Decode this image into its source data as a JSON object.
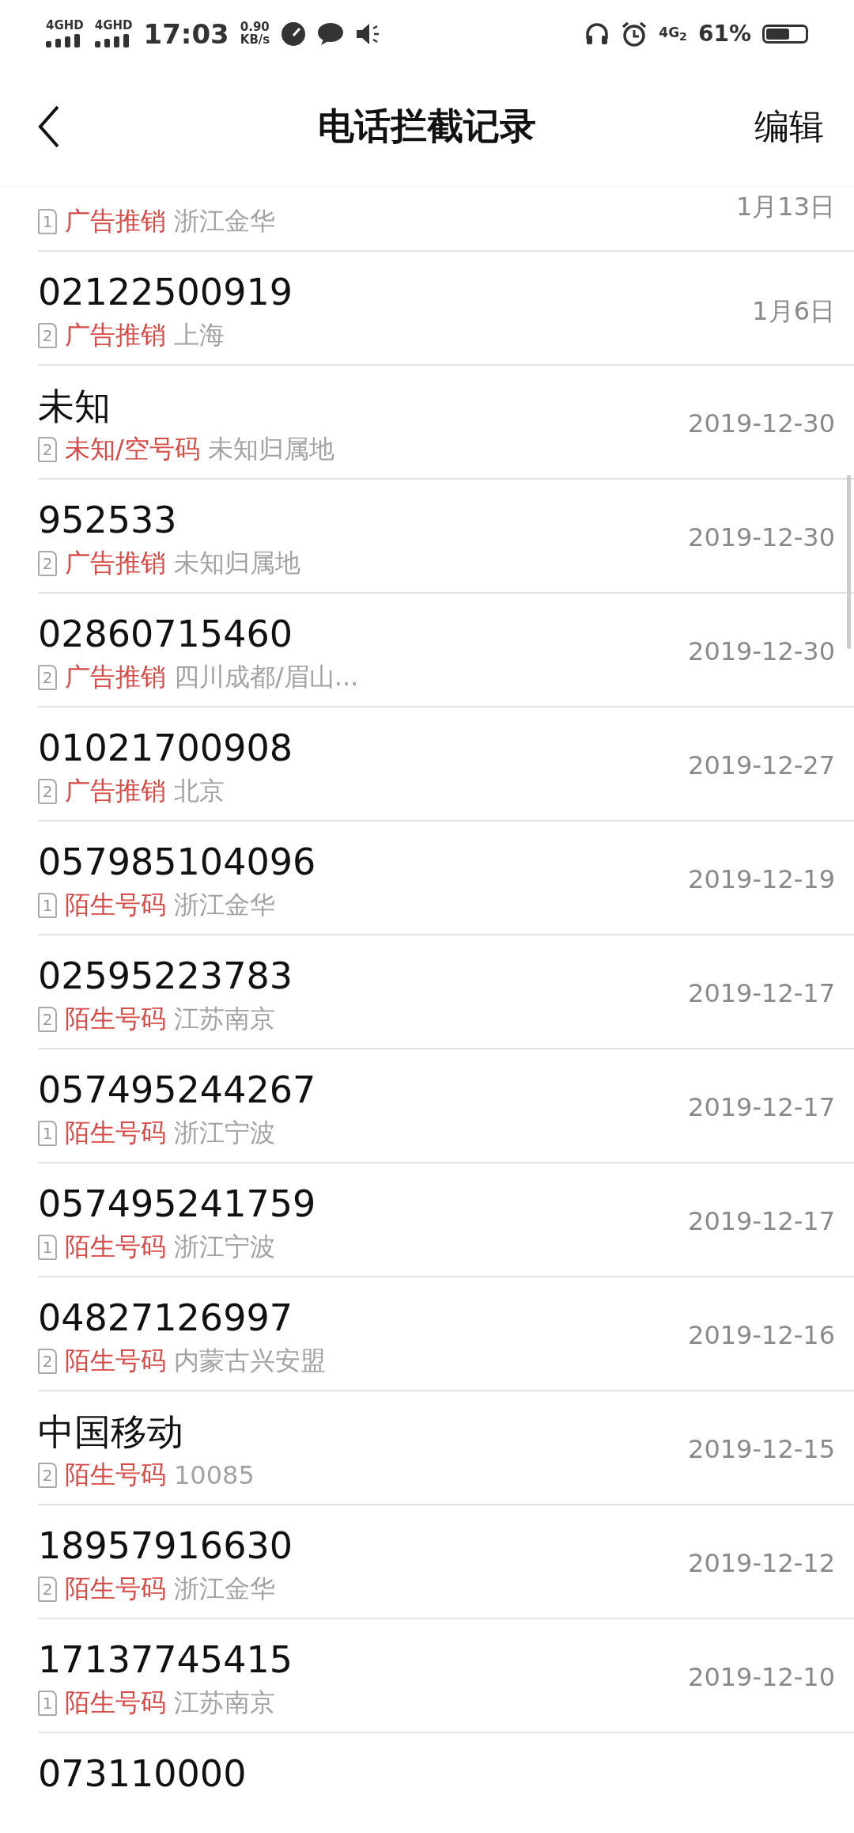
{
  "status_bar": {
    "signals": [
      {
        "label": "4GHD"
      },
      {
        "label": "4GHD"
      }
    ],
    "time": "17:03",
    "speed": {
      "value": "0.90",
      "unit": "KB/s"
    },
    "network": "4G",
    "network_sim": "2",
    "battery": "61%"
  },
  "header": {
    "title": "电话拦截记录",
    "action": "编辑"
  },
  "records": [
    {
      "sim": "1",
      "tag": "广告推销",
      "location": "浙江金华",
      "date": "1月13日"
    },
    {
      "number": "02122500919",
      "sim": "2",
      "tag": "广告推销",
      "location": "上海",
      "date": "1月6日"
    },
    {
      "number": "未知",
      "sim": "2",
      "tag": "未知/空号码",
      "location": "未知归属地",
      "date": "2019-12-30"
    },
    {
      "number": "952533",
      "sim": "2",
      "tag": "广告推销",
      "location": "未知归属地",
      "date": "2019-12-30"
    },
    {
      "number": "02860715460",
      "sim": "2",
      "tag": "广告推销",
      "location": "四川成都/眉山...",
      "date": "2019-12-30"
    },
    {
      "number": "01021700908",
      "sim": "2",
      "tag": "广告推销",
      "location": "北京",
      "date": "2019-12-27"
    },
    {
      "number": "057985104096",
      "sim": "1",
      "tag": "陌生号码",
      "location": "浙江金华",
      "date": "2019-12-19"
    },
    {
      "number": "02595223783",
      "sim": "2",
      "tag": "陌生号码",
      "location": "江苏南京",
      "date": "2019-12-17"
    },
    {
      "number": "057495244267",
      "sim": "1",
      "tag": "陌生号码",
      "location": "浙江宁波",
      "date": "2019-12-17"
    },
    {
      "number": "057495241759",
      "sim": "1",
      "tag": "陌生号码",
      "location": "浙江宁波",
      "date": "2019-12-17"
    },
    {
      "number": "04827126997",
      "sim": "2",
      "tag": "陌生号码",
      "location": "内蒙古兴安盟",
      "date": "2019-12-16"
    },
    {
      "number": "中国移动",
      "sim": "2",
      "tag": "陌生号码",
      "location": "10085",
      "date": "2019-12-15"
    },
    {
      "number": "18957916630",
      "sim": "2",
      "tag": "陌生号码",
      "location": "浙江金华",
      "date": "2019-12-12"
    },
    {
      "number": "17137745415",
      "sim": "1",
      "tag": "陌生号码",
      "location": "江苏南京",
      "date": "2019-12-10"
    },
    {
      "number": "073110000"
    }
  ]
}
